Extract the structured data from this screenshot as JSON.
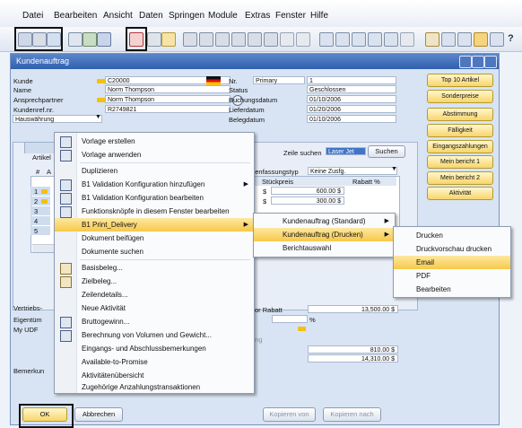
{
  "menubar": {
    "items": [
      {
        "label": "Datei"
      },
      {
        "label": "Bearbeiten"
      },
      {
        "label": "Ansicht"
      },
      {
        "label": "Daten"
      },
      {
        "label": "Springen"
      },
      {
        "label": "Module"
      },
      {
        "label": "Extras"
      },
      {
        "label": "Fenster"
      },
      {
        "label": "Hilfe"
      }
    ]
  },
  "toolbar": {
    "help_label": "?"
  },
  "window": {
    "title": "Kundenauftrag",
    "header_left": {
      "kunde_label": "Kunde",
      "kunde_value": "C20000",
      "name_label": "Name",
      "name_value": "Norm Thompson",
      "ansprech_label": "Ansprechpartner",
      "ansprech_value": "Norm Thompson",
      "kundenref_label": "Kundenref.nr.",
      "kundenref_value": "R2749821",
      "waehrung_value": "Hauswährung"
    },
    "header_right": {
      "nr_label": "Nr.",
      "nr_series": "Primary",
      "nr_value": "1",
      "status_label": "Status",
      "status_value": "Geschlossen",
      "buchungsdatum_label": "Buchungsdatum",
      "buchungsdatum_value": "01/10/2006",
      "lieferdatum_label": "Lieferdatum",
      "lieferdatum_value": "01/20/2006",
      "belegdatum_label": "Belegdatum",
      "belegdatum_value": "01/10/2006"
    },
    "side_buttons": [
      "Top 10 Artikel",
      "Sonderpreise",
      "Abstimmung",
      "Fälligkeit",
      "Eingangszahlungen",
      "Mein bericht 1",
      "Mein bericht 2",
      "Aktivität"
    ],
    "search": {
      "label": "Zeile suchen",
      "value": "Laser Jet",
      "button": "Suchen"
    },
    "zusammen_label": "...enfassungstyp",
    "zusammen_value": "Keine Zusfg.",
    "table": {
      "tab_label": "Artikel",
      "hash_label": "#",
      "a_label": "A",
      "col_stueckpreis": "Stückpreis",
      "col_rabatt": "Rabatt %",
      "rows": [
        {
          "n": "1",
          "curr": "$",
          "price": "600.00 $"
        },
        {
          "n": "2",
          "curr": "$",
          "price": "300.00 $"
        },
        {
          "n": "3"
        },
        {
          "n": "4"
        },
        {
          "n": "5"
        }
      ]
    },
    "footer": {
      "vertrieb_label": "Vertriebs-",
      "eigentum_label": "Eigentüm",
      "myudf_label": "My UDF",
      "bemerk_label": "Bemerkun",
      "rabatt_label": "or Rabatt",
      "rabatt_value": "13,500.00 $",
      "pct": "%",
      "zung_label": "ung",
      "total1": "810.00 $",
      "total2": "14,310.00 $"
    },
    "bottom_buttons": {
      "ok": "OK",
      "abbrechen": "Abbrechen",
      "kopieren_von": "Kopieren von",
      "kopieren_nach": "Kopieren nach"
    }
  },
  "context_menu": {
    "items": [
      "Vorlage erstellen",
      "Vorlage anwenden",
      "Duplizieren",
      "B1 Validation Konfiguration hinzufügen",
      "B1 Validation Konfiguration bearbeiten",
      "Funktionsknöpfe in diesem Fenster bearbeiten",
      "B1 Print_Delivery",
      "Dokument beifügen",
      "Dokumente suchen",
      "Basisbeleg...",
      "Zielbeleg...",
      "Zeilendetails...",
      "Neue Aktivität",
      "Bruttogewinn...",
      "Berechnung von Volumen und Gewicht...",
      "Eingangs- und Abschlussbemerkungen",
      "Available-to-Promise",
      "Aktivitätenübersicht",
      "Zugehörige Anzahlungstransaktionen"
    ]
  },
  "submenu1": {
    "items": [
      "Kundenauftrag (Standard)",
      "Kundenauftrag (Drucken)",
      "Berichtauswahl"
    ]
  },
  "submenu2": {
    "items": [
      "Drucken",
      "Druckvorschau drucken",
      "Email",
      "PDF",
      "Bearbeiten"
    ]
  },
  "colors": {
    "accent": "#2f5fae",
    "highlight": "#f7c94a",
    "button_gold": "#f8d56a"
  }
}
